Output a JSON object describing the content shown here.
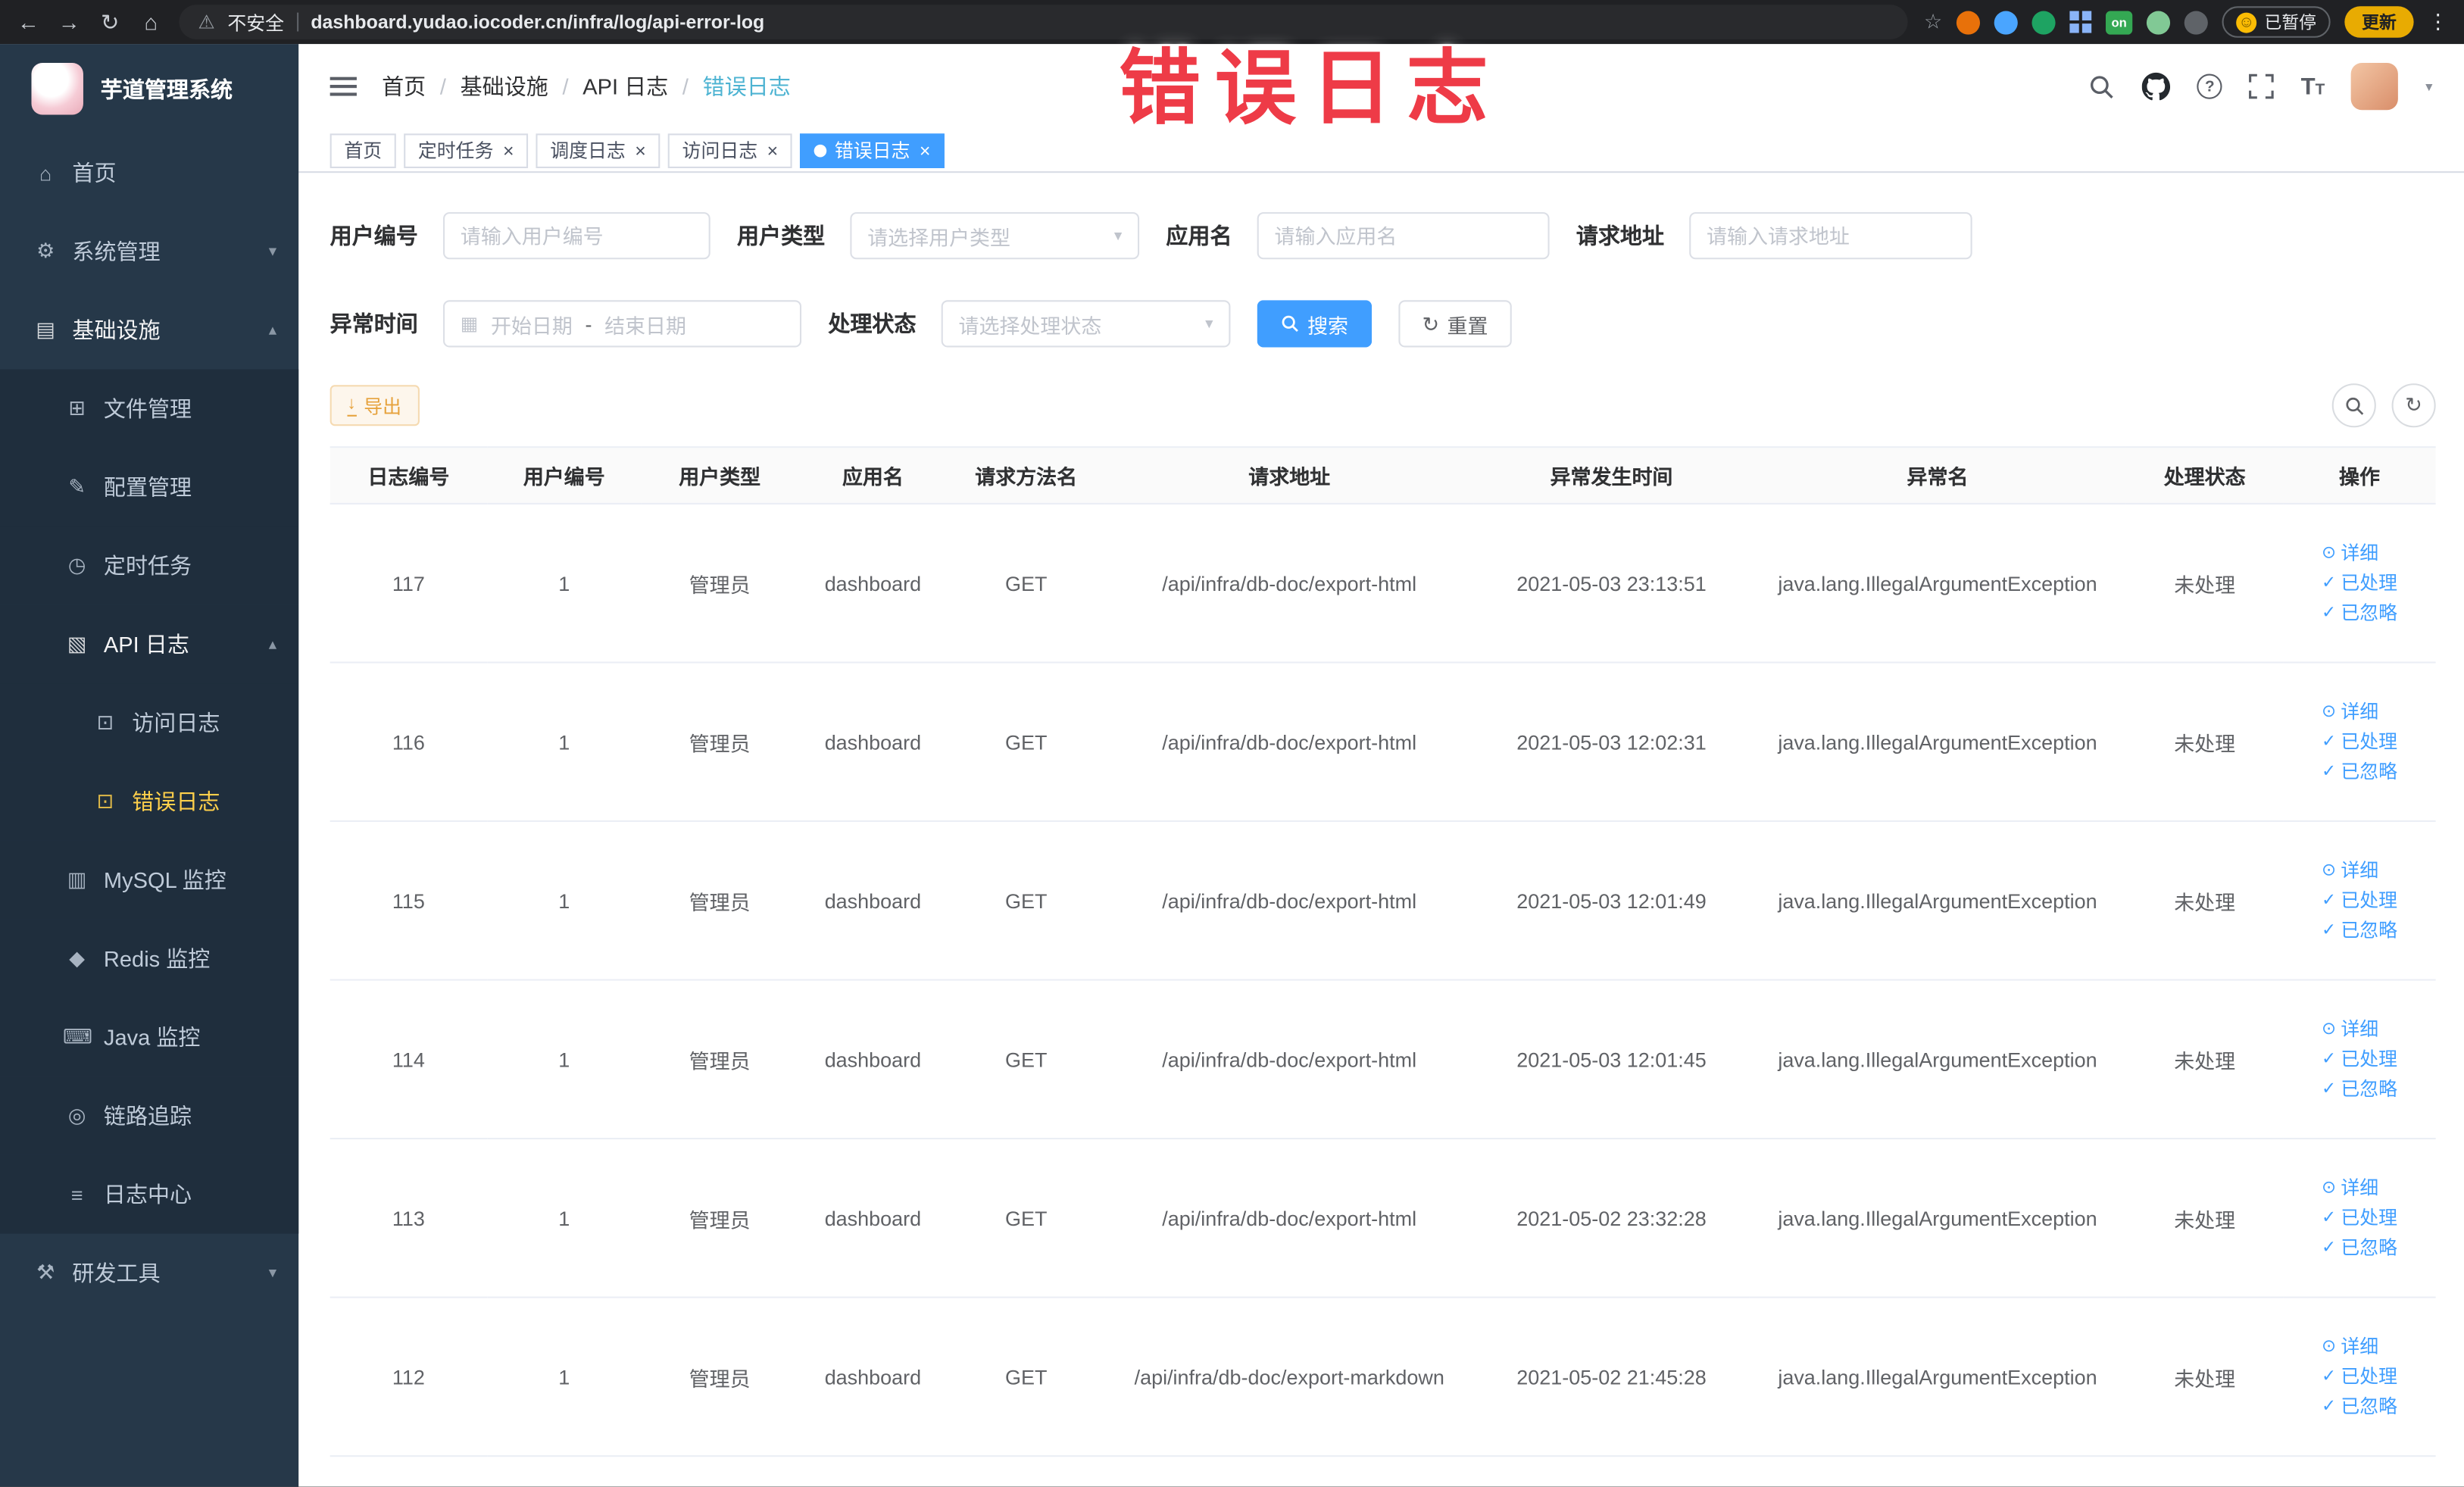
{
  "colors": {
    "accent": "#409eff",
    "sidebar_bg": "#263849",
    "sidebar_submenu_bg": "#1f2e3d",
    "sidebar_active_text": "#ffd04b",
    "watermark_red": "#ee3b47",
    "warning_button_text": "#e6a23c"
  },
  "watermark": "错误日志",
  "glyphs": {
    "caret_down": "▾",
    "calendar": "▦",
    "date_separator": "-",
    "reset": "↻",
    "refresh": "↻",
    "download": "↓",
    "question": "?",
    "font_large": "T",
    "font_small": "T"
  },
  "browser": {
    "icons": {
      "back": "←",
      "forward": "→",
      "reload": "↻",
      "home": "⌂",
      "warning": "⚠",
      "star": "☆",
      "menu": "⋮",
      "smiley": "☺"
    },
    "security_label": "不安全",
    "url": "dashboard.yudao.iocoder.cn/infra/log/api-error-log",
    "extension_badge": "on",
    "paused_label": "已暂停",
    "update_label": "更新"
  },
  "sidebar": {
    "logo_title": "芋道管理系统",
    "items": [
      {
        "key": "home",
        "label": "首页",
        "icon": "home-icon",
        "glyph": "⌂",
        "level": 1
      },
      {
        "key": "system",
        "label": "系统管理",
        "icon": "gear-icon",
        "glyph": "⚙",
        "level": 1,
        "arrow": "down"
      },
      {
        "key": "infra",
        "label": "基础设施",
        "icon": "monitor-icon",
        "glyph": "▤",
        "level": 1,
        "arrow": "up",
        "trail": true
      },
      {
        "key": "file",
        "label": "文件管理",
        "icon": "folder-icon",
        "glyph": "⊞",
        "level": 2
      },
      {
        "key": "config",
        "label": "配置管理",
        "icon": "edit-icon",
        "glyph": "✎",
        "level": 2
      },
      {
        "key": "job",
        "label": "定时任务",
        "icon": "timer-icon",
        "glyph": "◷",
        "level": 2
      },
      {
        "key": "api-log",
        "label": "API 日志",
        "icon": "log-icon",
        "glyph": "▧",
        "level": 2,
        "arrow": "up",
        "trail": true
      },
      {
        "key": "access-log",
        "label": "访问日志",
        "icon": "document-icon",
        "glyph": "⊡",
        "level": 3
      },
      {
        "key": "error-log",
        "label": "错误日志",
        "icon": "document-icon",
        "glyph": "⊡",
        "level": 3,
        "active": true
      },
      {
        "key": "mysql",
        "label": "MySQL 监控",
        "icon": "database-icon",
        "glyph": "▥",
        "level": 2
      },
      {
        "key": "redis",
        "label": "Redis 监控",
        "icon": "redis-icon",
        "glyph": "◆",
        "level": 2
      },
      {
        "key": "java",
        "label": "Java 监控",
        "icon": "java-icon",
        "glyph": "⌨",
        "level": 2
      },
      {
        "key": "trace",
        "label": "链路追踪",
        "icon": "trace-icon",
        "glyph": "◎",
        "level": 2
      },
      {
        "key": "log-center",
        "label": "日志中心",
        "icon": "log-center-icon",
        "glyph": "≡",
        "level": 2
      },
      {
        "key": "dev-tools",
        "label": "研发工具",
        "icon": "tools-icon",
        "glyph": "⚒",
        "level": 1,
        "arrow": "down"
      }
    ]
  },
  "header": {
    "breadcrumb": [
      "首页",
      "基础设施",
      "API 日志",
      "错误日志"
    ]
  },
  "tabs": [
    {
      "key": "home",
      "label": "首页",
      "closable": false,
      "active": false
    },
    {
      "key": "job",
      "label": "定时任务",
      "closable": true,
      "active": false
    },
    {
      "key": "job-log",
      "label": "调度日志",
      "closable": true,
      "active": false
    },
    {
      "key": "access-log",
      "label": "访问日志",
      "closable": true,
      "active": false
    },
    {
      "key": "error-log",
      "label": "错误日志",
      "closable": true,
      "active": true
    }
  ],
  "filters": {
    "user_id": {
      "label": "用户编号",
      "placeholder": "请输入用户编号"
    },
    "user_type": {
      "label": "用户类型",
      "placeholder": "请选择用户类型"
    },
    "app_name": {
      "label": "应用名",
      "placeholder": "请输入应用名"
    },
    "request_url": {
      "label": "请求地址",
      "placeholder": "请输入请求地址"
    },
    "exception_time": {
      "label": "异常时间",
      "start_placeholder": "开始日期",
      "end_placeholder": "结束日期"
    },
    "process_status": {
      "label": "处理状态",
      "placeholder": "请选择处理状态"
    },
    "search_label": "搜索",
    "reset_label": "重置"
  },
  "toolbar": {
    "export_label": "导出"
  },
  "table": {
    "columns": [
      "日志编号",
      "用户编号",
      "用户类型",
      "应用名",
      "请求方法名",
      "请求地址",
      "异常发生时间",
      "异常名",
      "处理状态",
      "操作"
    ],
    "actions": [
      {
        "key": "detail",
        "label": "详细",
        "icon": "view-icon",
        "glyph": "⊙"
      },
      {
        "key": "processed",
        "label": "已处理",
        "icon": "check-icon",
        "glyph": "✓"
      },
      {
        "key": "ignore",
        "label": "已忽略",
        "icon": "check-icon",
        "glyph": "✓"
      }
    ],
    "rows": [
      {
        "id": "117",
        "user_id": "1",
        "user_type": "管理员",
        "app": "dashboard",
        "method": "GET",
        "url": "/api/infra/db-doc/export-html",
        "time": "2021-05-03 23:13:51",
        "exception": "java.lang.IllegalArgumentException",
        "status": "未处理"
      },
      {
        "id": "116",
        "user_id": "1",
        "user_type": "管理员",
        "app": "dashboard",
        "method": "GET",
        "url": "/api/infra/db-doc/export-html",
        "time": "2021-05-03 12:02:31",
        "exception": "java.lang.IllegalArgumentException",
        "status": "未处理"
      },
      {
        "id": "115",
        "user_id": "1",
        "user_type": "管理员",
        "app": "dashboard",
        "method": "GET",
        "url": "/api/infra/db-doc/export-html",
        "time": "2021-05-03 12:01:49",
        "exception": "java.lang.IllegalArgumentException",
        "status": "未处理"
      },
      {
        "id": "114",
        "user_id": "1",
        "user_type": "管理员",
        "app": "dashboard",
        "method": "GET",
        "url": "/api/infra/db-doc/export-html",
        "time": "2021-05-03 12:01:45",
        "exception": "java.lang.IllegalArgumentException",
        "status": "未处理"
      },
      {
        "id": "113",
        "user_id": "1",
        "user_type": "管理员",
        "app": "dashboard",
        "method": "GET",
        "url": "/api/infra/db-doc/export-html",
        "time": "2021-05-02 23:32:28",
        "exception": "java.lang.IllegalArgumentException",
        "status": "未处理"
      },
      {
        "id": "112",
        "user_id": "1",
        "user_type": "管理员",
        "app": "dashboard",
        "method": "GET",
        "url": "/api/infra/db-doc/export-markdown",
        "time": "2021-05-02 21:45:28",
        "exception": "java.lang.IllegalArgumentException",
        "status": "未处理"
      }
    ]
  }
}
